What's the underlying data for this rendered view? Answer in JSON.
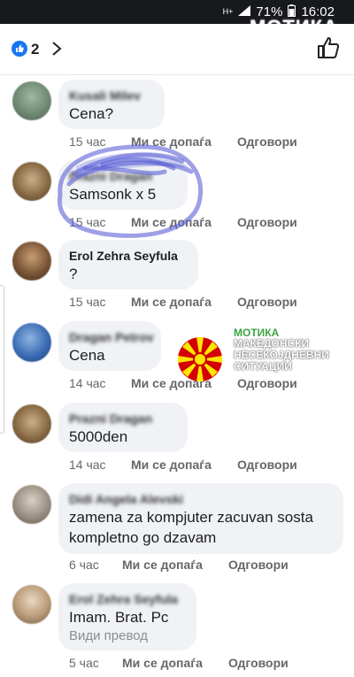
{
  "status_bar": {
    "network_small": "H+",
    "battery": "71%",
    "time": "16:02"
  },
  "watermark": "МОТИКА",
  "header": {
    "reaction_count": "2",
    "like_icon": "thumbs-up-icon",
    "accent": "#1877f2"
  },
  "actions_labels": {
    "like": "Ми се допаѓа",
    "reply": "Одговори"
  },
  "comments": [
    {
      "author": "Kusali Milev",
      "author_blurred": true,
      "text": "Cena?",
      "time": "15 час"
    },
    {
      "author": "Prazni Dragan",
      "author_blurred": true,
      "text": "Samsonk x 5",
      "time": "15 час"
    },
    {
      "author": "Erol Zehra Seyfula",
      "author_blurred": false,
      "text": "?",
      "time": "15 час"
    },
    {
      "author": "Dragan Petrov",
      "author_blurred": true,
      "text": "Cena",
      "time": "14 час"
    },
    {
      "author": "Prazni Dragan",
      "author_blurred": true,
      "text": "5000den",
      "time": "14 час"
    },
    {
      "author": "Didi Angela Alevski",
      "author_blurred": true,
      "text": "zamena za kompjuter zacuvan  sosta",
      "text2": "kompletno go dzavam",
      "time": "6 час"
    },
    {
      "author": "Erol Zehra Seyfula",
      "author_blurred": true,
      "text": "Imam. Brat. Pc",
      "translate": "Види превод",
      "time": "5 час"
    }
  ],
  "brand": {
    "name": "МОТИКА",
    "tagline": "МАКЕДОНСКИ\nНЕСЕКОЈДНЕВНИ\nСИТУАЦИИ",
    "flag_colors": [
      "#d20000",
      "#ffe600"
    ]
  }
}
